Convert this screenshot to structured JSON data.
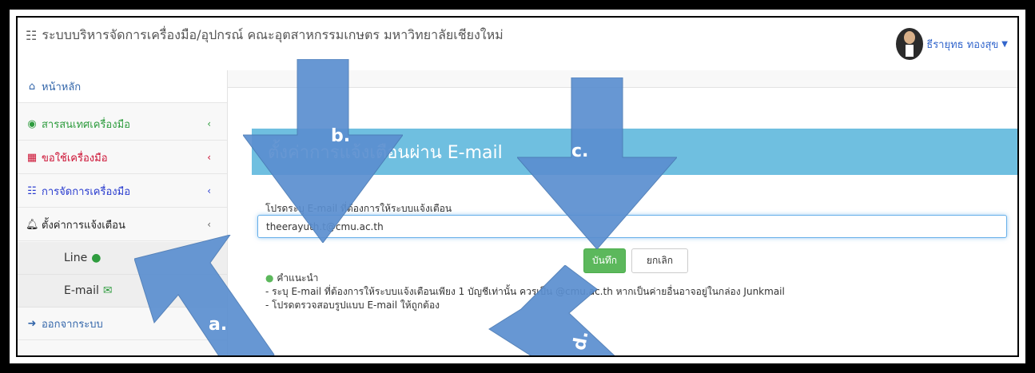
{
  "header": {
    "app_title": "ระบบบริหารจัดการเครื่องมือ/อุปกรณ์ คณะอุตสาหกรรมเกษตร มหาวิทยาลัยเชียงใหม่",
    "user_name": "ธีรายุทธ ทองสุข"
  },
  "sidebar": {
    "home": "หน้าหลัก",
    "items": [
      {
        "label": "สารสนเทศเครื่องมือ",
        "color": "#2e9c3e"
      },
      {
        "label": "ขอใช้เครื่องมือ",
        "color": "#cc1133"
      },
      {
        "label": "การจัดการเครื่องมือ",
        "color": "#2a3ccf"
      },
      {
        "label": "ตั้งค่าการแจ้งเตือน",
        "color": "#222222"
      }
    ],
    "sub_items": [
      {
        "label": "Line"
      },
      {
        "label": "E-mail"
      }
    ],
    "logout": "ออกจากระบบ"
  },
  "main": {
    "panel_title": "ตั้งค่าการแจ้งเตือนผ่าน E-mail",
    "field_label": "โปรดระบุ E-mail ที่ต้องการให้ระบบแจ้งเตือน",
    "email_value": "theerayuth.t@cmu.ac.th",
    "save_label": "บันทึก",
    "cancel_label": "ยกเลิก",
    "advice_title": "คำแนะนำ",
    "advice_line1": "- ระบุ E-mail ที่ต้องการให้ระบบแจ้งเตือนเพียง 1 บัญชีเท่านั้น ควรเป็น @cmu.ac.th หากเป็นค่ายอื่นอาจอยู่ในกล่อง Junkmail",
    "advice_line2": "- โปรดตรวจสอบรูปแบบ E-mail ให้ถูกต้อง"
  },
  "annotations": {
    "a": "a.",
    "b": "b.",
    "c": "c.",
    "d": "d."
  },
  "colors": {
    "accent": "#6fbfe0",
    "save": "#5cb85c",
    "arrow": "#5b8fd0"
  }
}
